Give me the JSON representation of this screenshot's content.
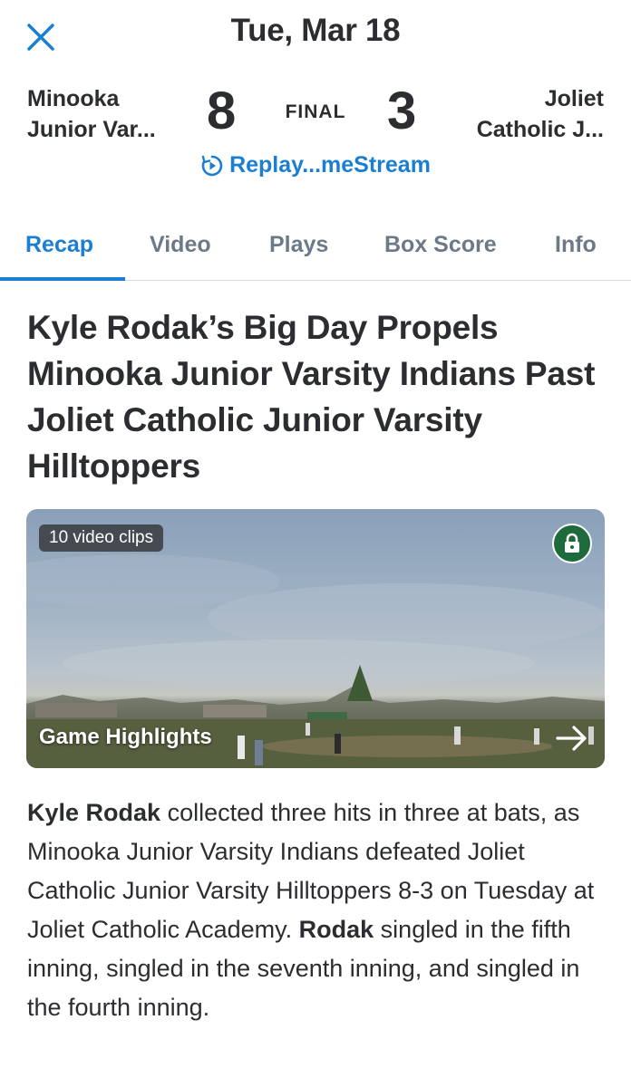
{
  "header": {
    "date": "Tue, Mar 18",
    "close_icon": "close-icon"
  },
  "scoreboard": {
    "home": {
      "name_line1": "Minooka",
      "name_line2": "Junior Var...",
      "score": "8"
    },
    "away": {
      "name_line1": "Joliet",
      "name_line2": "Catholic J...",
      "score": "3"
    },
    "status": "FINAL",
    "replay_label": "Replay...meStream",
    "replay_icon": "replay-icon"
  },
  "tabs": [
    {
      "label": "Recap",
      "active": true
    },
    {
      "label": "Video",
      "active": false
    },
    {
      "label": "Plays",
      "active": false
    },
    {
      "label": "Box Score",
      "active": false
    },
    {
      "label": "Info",
      "active": false
    }
  ],
  "headline": "Kyle Rodak’s Big Day Propels Minooka Junior Varsity Indians Past Joliet Catholic Junior Varsity Hilltoppers",
  "video": {
    "clips_badge": "10 video clips",
    "title": "Game Highlights",
    "lock_icon": "lock-icon",
    "arrow_icon": "arrow-right-icon"
  },
  "article": {
    "player_name": "Kyle Rodak",
    "text_1": " collected three hits in three at bats, as Minooka Junior Varsity Indians defeated Joliet Catholic Junior Varsity Hilltoppers 8-3 on Tuesday at Joliet Catholic Academy. ",
    "player_short": "Rodak",
    "text_2": " singled in the fifth inning, singled in the seventh inning, and singled in the fourth inning."
  },
  "colors": {
    "accent": "#1a7fd0",
    "text": "#2b2d31",
    "tab_inactive": "#6c7a88",
    "lock_badge": "#1d6a3d"
  }
}
